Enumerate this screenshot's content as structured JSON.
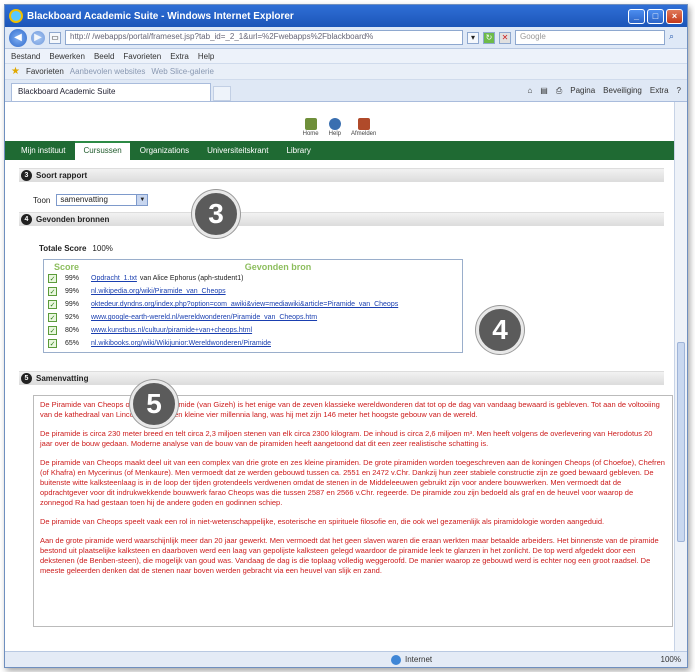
{
  "window": {
    "title": "Blackboard Academic Suite - Windows Internet Explorer",
    "buttons": [
      "_",
      "□",
      "×"
    ]
  },
  "address": {
    "url": "http://                    /webapps/portal/frameset.jsp?tab_id=_2_1&url=%2Fwebapps%2Fblackboard%",
    "search_placeholder": "Google"
  },
  "menu": [
    "Bestand",
    "Bewerken",
    "Beeld",
    "Favorieten",
    "Extra",
    "Help"
  ],
  "favorites": {
    "label": "Favorieten",
    "items": [
      "Aanbevolen websites",
      "Web Slice-galerie"
    ]
  },
  "tab": {
    "label": "Blackboard Academic Suite"
  },
  "commands": [
    "Pagina",
    "Beveiliging",
    "Extra"
  ],
  "bb_top": [
    {
      "icon": "home-icon",
      "label": "Home"
    },
    {
      "icon": "help-icon",
      "label": "Help"
    },
    {
      "icon": "logout-icon",
      "label": "Afmelden"
    }
  ],
  "bb_nav": [
    "Mijn instituut",
    "Cursussen",
    "Organizations",
    "Universiteitskrant",
    "Library"
  ],
  "section3": {
    "num": "3",
    "title": "Soort rapport"
  },
  "toon": {
    "label": "Toon",
    "value": "samenvatting"
  },
  "section4": {
    "num": "4",
    "title": "Gevonden bronnen"
  },
  "score": {
    "label": "Totale Score",
    "value": "100%"
  },
  "sources": {
    "head_score": "Score",
    "head_source": "Gevonden bron",
    "rows": [
      {
        "pct": "99%",
        "link": "Opdracht_1.txt",
        "rest": "van Alice Ephorus (aph-student1)"
      },
      {
        "pct": "99%",
        "link": "nl.wikipedia.org/wiki/Piramide_van_Cheops",
        "rest": ""
      },
      {
        "pct": "99%",
        "link": "oktedeur.dyndns.org/index.php?option=com_awiki&view=mediawiki&article=Piramide_van_Cheops",
        "rest": ""
      },
      {
        "pct": "92%",
        "link": "www.google-earth-wereld.nl/wereldwonderen/Piramide_van_Cheops.htm",
        "rest": ""
      },
      {
        "pct": "80%",
        "link": "www.kunstbus.nl/cultuur/piramide+van+cheops.html",
        "rest": ""
      },
      {
        "pct": "65%",
        "link": "nl.wikibooks.org/wiki/Wikijunior:Wereldwonderen/Piramide",
        "rest": ""
      }
    ]
  },
  "section5": {
    "num": "5",
    "title": "Samenvatting"
  },
  "summary": [
    "De Piramide van Cheops of de Grote Piramide (van Gizeh) is het enige van de zeven klassieke wereldwonderen dat tot op de dag van vandaag bewaard is gebleven. Tot aan de voltooiing van de kathedraal van Lincoln in 1311, een kleine vier millennia lang, was hij met zijn 146 meter het hoogste gebouw van de wereld.",
    "De piramide is circa 230 meter breed en telt circa 2,3 miljoen stenen van elk circa 2300 kilogram. De inhoud is circa 2,6 miljoen m³. Men heeft volgens de overlevering van Herodotus 20 jaar over de bouw gedaan. Moderne analyse van de bouw van de piramiden heeft aangetoond dat dit een zeer realistische schatting is.",
    "De piramide van Cheops maakt deel uit van een complex van drie grote en zes kleine piramiden. De grote piramiden worden toegeschreven aan de koningen Cheops (of Choefoe), Chefren (of Khafra) en Mycerinus (of Menkaure). Men vermoedt dat ze werden gebouwd tussen ca. 2551 en 2472 v.Chr. Dankzij hun zeer stabiele constructie zijn ze goed bewaard gebleven. De buitenste witte kalksteenlaag is in de loop der tijden grotendeels verdwenen omdat de stenen in de Middeleeuwen gebruikt zijn voor andere bouwwerken. Men vermoedt dat de opdrachtgever voor dit indrukwekkende bouwwerk farao Cheops was die tussen 2587 en 2566 v.Chr. regeerde. De piramide zou zijn bedoeld als graf en de heuvel voor waarop de zonnegod Ra had gestaan toen hij de andere goden en godinnen schiep.",
    "De piramide van Cheops speelt vaak een rol in niet-wetenschappelijke, esoterische en spirituele filosofie en, die ook wel gezamenlijk als piramidologie worden aangeduid.",
    "Aan de grote piramide werd waarschijnlijk meer dan 20 jaar gewerkt. Men vermoedt dat het geen slaven waren die eraan werkten maar betaalde arbeiders. Het binnenste van de piramide bestond uit plaatselijke kalksteen en daarboven werd een laag van gepolijste kalksteen gelegd waardoor de piramide leek te glanzen in het zonlicht. De top werd afgedekt door een dekstenen (de Benben-steen), die mogelijk van goud was. Vandaag de dag is die toplaag volledig weggeroofd. De manier waarop ze gebouwd werd is echter nog een groot raadsel. De meeste geleerden denken dat de stenen naar boven werden gebracht via een heuvel van slijk en zand."
  ],
  "badges": {
    "b3": "3",
    "b4": "4",
    "b5": "5"
  },
  "status": {
    "zone": "Internet",
    "zoom": "100%"
  }
}
